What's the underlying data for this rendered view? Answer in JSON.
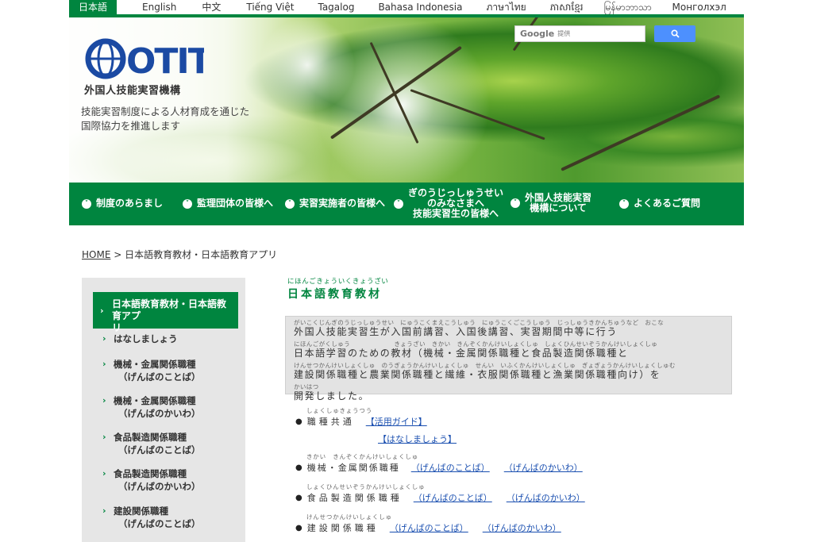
{
  "language_bar": {
    "items": [
      "日本語",
      "English",
      "中文",
      "Tiếng Việt",
      "Tagalog",
      "Bahasa Indonesia",
      "ภาษาไทย",
      "ភាសាខ្មែរ",
      "မြန်မာဘာသာ",
      "Монголхэл"
    ],
    "active": "日本語"
  },
  "header": {
    "logo_text": "OTIT",
    "org_name": "外国人技能実習機構",
    "tagline": [
      "技能実習制度による人材育成を通じた",
      "国際協力を推進します"
    ],
    "search": {
      "brand": "Google",
      "provided_label": "提供"
    }
  },
  "main_nav": {
    "items": [
      {
        "label": "制度のあらまし"
      },
      {
        "label": "監理団体の皆様へ"
      },
      {
        "label": "実習実施者の皆様へ"
      },
      {
        "label_lines": [
          "ぎのうじっしゅうせい",
          "のみなさまへ",
          "技能実習生の皆様へ"
        ]
      },
      {
        "label_lines": [
          "外国人技能実習",
          "機構について"
        ]
      },
      {
        "label": "よくあるご質問"
      }
    ]
  },
  "breadcrumb": {
    "home": "HOME",
    "separator": ">",
    "current": "日本語教育教材・日本語教育アプリ"
  },
  "sidebar": {
    "active": [
      "日本語教育教材・日本語教育アプ",
      "リ"
    ],
    "items": [
      {
        "line1": "はなしましょう",
        "line2": ""
      },
      {
        "line1": "機械・金属関係職種",
        "line2": "（げんばのことば）"
      },
      {
        "line1": "機械・金属関係職種",
        "line2": "（げんばのかいわ）"
      },
      {
        "line1": "食品製造関係職種",
        "line2": "（げんばのことば）"
      },
      {
        "line1": "食品製造関係職種",
        "line2": "（げんばのかいわ）"
      },
      {
        "line1": "建設関係職種",
        "line2": "（げんばのことば）"
      }
    ]
  },
  "content": {
    "title_ruby": "にほんごきょういくきょうざい",
    "title": "日本語教育教材",
    "intro": [
      {
        "ruby": "がいこくじんぎのうじっしゅうせい　にゅうこくまえこうしゅう　にゅうこくごこうしゅう　じっしゅうきかんちゅうなど　おこな",
        "text": "外国人技能実習生が入国前講習、入国後講習、実習期間中等に行う"
      },
      {
        "ruby": "にほんごがくしゅう　　　　　　　きょうざい　きかい　きんぞくかんけいしょくしゅ　しょくひんせいぞうかんけいしょくしゅ",
        "text": "日本語学習のための教材（機械・金属関係職種と食品製造関係職種と"
      },
      {
        "ruby": "けんせつかんけいしょくしゅ　のうぎょうかんけいしょくしゅ　せんい　いふくかんけいしょくしゅ　ぎょぎょうかんけいしょくしゅむ",
        "text": "建設関係職種と農業関係職種と繊維・衣服関係職種と漁業関係職種向け）を"
      },
      {
        "ruby": "かいはつ",
        "text": "開発しました。"
      }
    ],
    "rows": [
      {
        "ruby": "しょくしゅきょうつう",
        "name": "職種共通",
        "links": [
          "【活用ガイド】"
        ],
        "sub_links": [
          "【はなしましょう】"
        ]
      },
      {
        "ruby": "きかい　きんぞくかんけいしょくしゅ",
        "name": "機械・金属関係職種",
        "links": [
          "（げんばのことば）",
          "（げんばのかいわ）"
        ]
      },
      {
        "ruby": "しょくひんせいぞうかんけいしょくしゅ",
        "name": "食品製造関係職種",
        "links": [
          "（げんばのことば）",
          "（げんばのかいわ）"
        ]
      },
      {
        "ruby": "けんせつかんけいしょくしゅ",
        "name": "建設関係職種",
        "links": [
          "（げんばのことば）",
          "（げんばのかいわ）"
        ]
      }
    ]
  },
  "colors": {
    "brand_green": "#00853f",
    "logo_blue": "#1b4aa3",
    "link_blue": "#1a4fb0",
    "search_button": "#4d90fe"
  }
}
